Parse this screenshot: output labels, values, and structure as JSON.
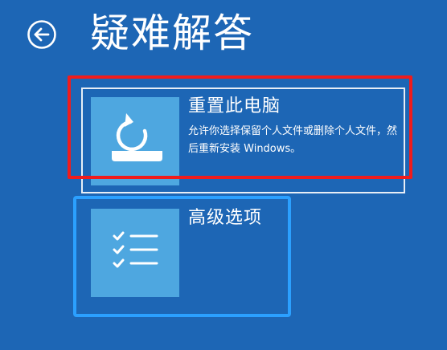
{
  "page": {
    "title": "疑难解答",
    "background_color": "#1d66b5"
  },
  "back_button": {
    "icon": "back-arrow-icon"
  },
  "options": [
    {
      "title": "重置此电脑",
      "description": "允许你选择保留个人文件或删除个人文件，然后重新安装 Windows。",
      "icon": "reset-pc-icon",
      "selected": true
    },
    {
      "title": "高级选项",
      "icon": "checklist-icon",
      "selected": false
    }
  ],
  "colors": {
    "tile_icon_background": "#4ea7e0",
    "highlight_red": "#f01c1c",
    "highlight_blue": "#2ba0ff"
  }
}
